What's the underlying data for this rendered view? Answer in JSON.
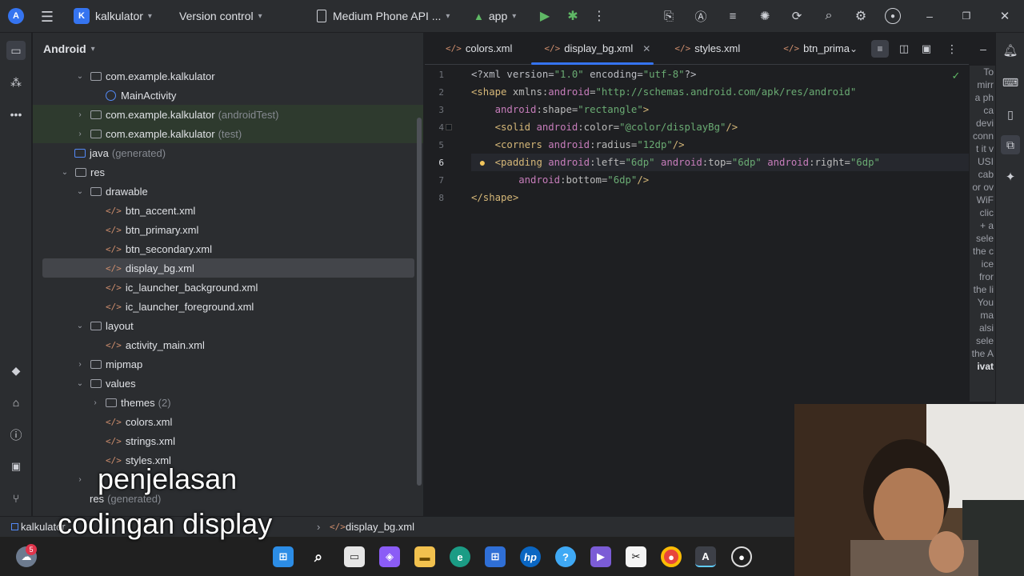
{
  "toolbar": {
    "project_badge": "K",
    "project_name": "kalkulator",
    "vcs": "Version control",
    "device": "Medium Phone API ...",
    "run_config": "app"
  },
  "project_panel": {
    "title": "Android",
    "rows": [
      {
        "label": "com.example.kalkulator",
        "extra": ""
      },
      {
        "label": "MainActivity",
        "extra": ""
      },
      {
        "label": "com.example.kalkulator",
        "extra": "(androidTest)"
      },
      {
        "label": "com.example.kalkulator",
        "extra": "(test)"
      },
      {
        "label": "java",
        "extra": "(generated)"
      },
      {
        "label": "res",
        "extra": ""
      },
      {
        "label": "drawable",
        "extra": ""
      },
      {
        "label": "btn_accent.xml",
        "extra": ""
      },
      {
        "label": "btn_primary.xml",
        "extra": ""
      },
      {
        "label": "btn_secondary.xml",
        "extra": ""
      },
      {
        "label": "display_bg.xml",
        "extra": ""
      },
      {
        "label": "ic_launcher_background.xml",
        "extra": ""
      },
      {
        "label": "ic_launcher_foreground.xml",
        "extra": ""
      },
      {
        "label": "layout",
        "extra": ""
      },
      {
        "label": "activity_main.xml",
        "extra": ""
      },
      {
        "label": "mipmap",
        "extra": ""
      },
      {
        "label": "values",
        "extra": ""
      },
      {
        "label": "themes",
        "extra": "(2)"
      },
      {
        "label": "colors.xml",
        "extra": ""
      },
      {
        "label": "strings.xml",
        "extra": ""
      },
      {
        "label": "styles.xml",
        "extra": ""
      },
      {
        "label": "res",
        "extra": "(generated)"
      }
    ]
  },
  "tabs": [
    {
      "label": "colors.xml"
    },
    {
      "label": "display_bg.xml"
    },
    {
      "label": "styles.xml"
    },
    {
      "label": "btn_prima"
    }
  ],
  "code": {
    "line_numbers": [
      "1",
      "2",
      "3",
      "4",
      "5",
      "6",
      "7",
      "8"
    ]
  },
  "hint_text": [
    "To",
    "mirr",
    "a ph",
    "ca",
    "devi",
    "conn",
    "t it v",
    "USI",
    "cab",
    "or ov",
    "WiF",
    "clic",
    "+ a",
    "sele",
    "the c",
    "ice",
    "fror",
    "the li",
    "You",
    "ma",
    "alsi",
    "sele",
    "the A",
    "ivat"
  ],
  "status_bar": {
    "crumb_project": "kalkulator",
    "crumb_file": "display_bg.xml"
  },
  "captions": {
    "line1": "penjelasan",
    "line2": "codingan display"
  },
  "taskbar": {
    "notification_count": "5"
  },
  "colors": {
    "accent": "#3574f0",
    "background": "#1e1f22",
    "panel": "#2b2d30"
  }
}
